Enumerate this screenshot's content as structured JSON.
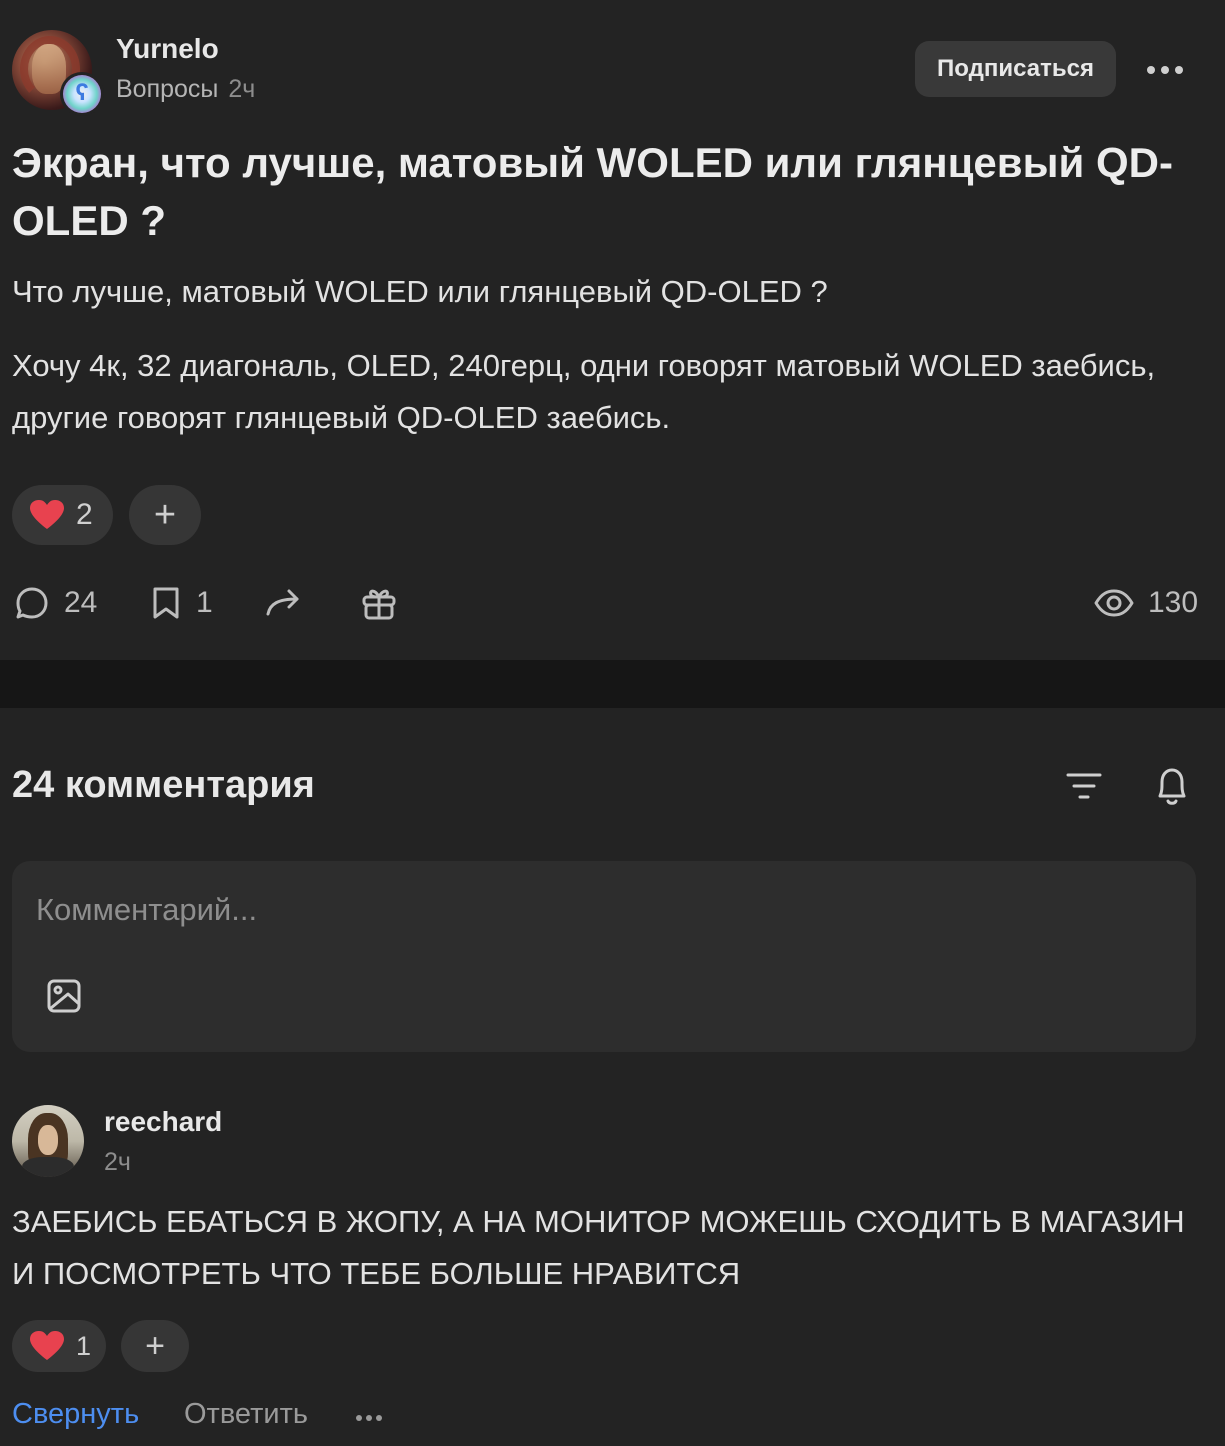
{
  "post": {
    "author": "Yurnelo",
    "community": "Вопросы",
    "time": "2ч",
    "subscribe_label": "Подписаться",
    "title": "Экран, что лучше, матовый WOLED или глянцевый QD-OLED ?",
    "body": [
      "Что лучше, матовый WOLED или глянцевый QD-OLED ?",
      "Хочу 4к, 32 диагональ, OLED, 240герц, одни говорят матовый WOLED заебись, другие говорят глянцевый QD-OLED заебись."
    ],
    "reactions": {
      "heart_count": "2",
      "add_label": "+"
    },
    "stats": {
      "comments": "24",
      "bookmarks": "1",
      "views": "130"
    }
  },
  "comments_section": {
    "title": "24 комментария",
    "input_placeholder": "Комментарий..."
  },
  "comment": {
    "author": "reechard",
    "time": "2ч",
    "text": "ЗАЕБИСЬ ЕБАТЬСЯ В ЖОПУ, А НА МОНИТОР МОЖЕШЬ СХОДИТЬ В МАГАЗИН И ПОСМОТРЕТЬ ЧТО ТЕБЕ БОЛЬШЕ НРАВИТСЯ",
    "heart_count": "1",
    "add_label": "+",
    "collapse_label": "Свернуть",
    "reply_label": "Ответить"
  },
  "colors": {
    "background": "#232323",
    "separator": "#161616",
    "heart": "#e8424f",
    "link": "#4d8ef0"
  },
  "icons": [
    "comment-icon",
    "bookmark-icon",
    "share-icon",
    "gift-icon",
    "eye-icon",
    "filter-icon",
    "bell-icon",
    "image-icon",
    "heart-icon",
    "more-icon"
  ]
}
